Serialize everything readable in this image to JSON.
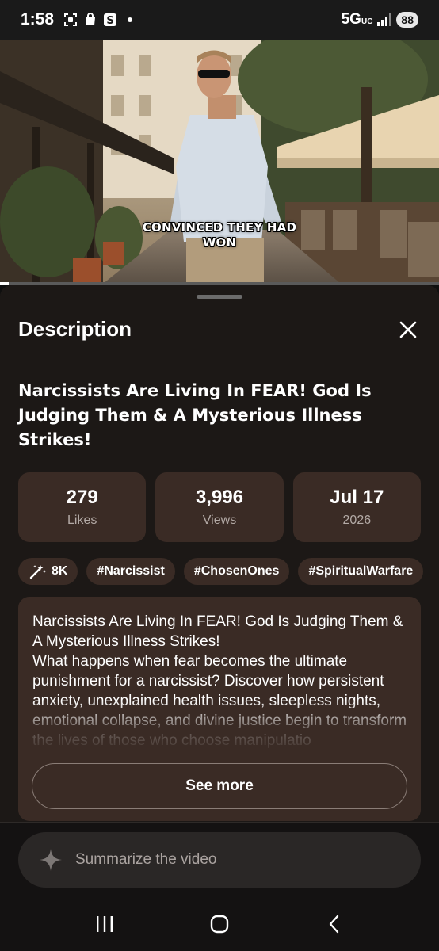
{
  "status_bar": {
    "time": "1:58",
    "network": "5G",
    "network_sub": "UC",
    "battery": "88"
  },
  "video": {
    "caption_line1": "CONVINCED THEY HAD",
    "caption_line2": "WON",
    "progress_fraction": 0.02
  },
  "description_sheet": {
    "title": "Description",
    "close_icon": "close-icon",
    "video_title": "Narcissists Are Living In FEAR! God Is Judging Them & A Mysterious Illness Strikes!",
    "stats": [
      {
        "value": "279",
        "label": "Likes"
      },
      {
        "value": "3,996",
        "label": "Views"
      },
      {
        "value": "Jul 17",
        "label": "2026"
      }
    ],
    "chips": [
      {
        "label": "8K",
        "icon": "magic-wand-icon"
      },
      {
        "label": "#Narcissist"
      },
      {
        "label": "#ChosenOnes"
      },
      {
        "label": "#SpiritualWarfare"
      }
    ],
    "description_text": "Narcissists Are Living In FEAR! God Is Judging Them & A Mysterious Illness Strikes!\nWhat happens when fear becomes the ultimate punishment for a narcissist? Discover how persistent anxiety, unexplained health issues, sleepless nights, emotional collapse, and divine justice begin to transform the lives of those who choose manipulatio",
    "see_more_label": "See more"
  },
  "summarize": {
    "placeholder": "Summarize the video",
    "icon": "sparkle-icon"
  },
  "nav_bar": {
    "recents_icon": "recents-icon",
    "home_icon": "home-icon",
    "back_icon": "back-icon"
  },
  "colors": {
    "sheet_bg": "#1c1816",
    "card_bg": "#3a2b25",
    "text_primary": "#ffffff",
    "text_secondary": "#b3aaa6"
  }
}
